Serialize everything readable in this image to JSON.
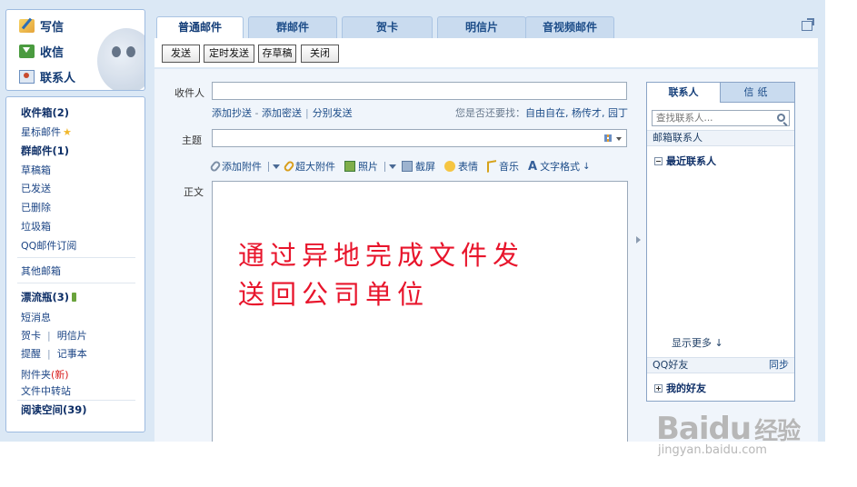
{
  "sidebar": {
    "top": [
      {
        "label": "写信",
        "icon": "pencil-icon"
      },
      {
        "label": "收信",
        "icon": "inbox-icon"
      },
      {
        "label": "联系人",
        "icon": "contact-card-icon"
      }
    ],
    "inbox": "收件箱(2)",
    "starred": "星标邮件",
    "group_mail": "群邮件(1)",
    "drafts": "草稿箱",
    "sent": "已发送",
    "deleted": "已删除",
    "trash": "垃圾箱",
    "subscriptions": "QQ邮件订阅",
    "other_mailboxes": "其他邮箱",
    "drift_bottle": "漂流瓶(3)",
    "sms": "短消息",
    "greeting_card": "贺卡",
    "postcard": "明信片",
    "reminder": "提醒",
    "notebook": "记事本",
    "attachments": "附件夹",
    "attachments_new": "(新)",
    "file_transfer": "文件中转站",
    "reading_space": "阅读空间(39)"
  },
  "tabs": [
    "普通邮件",
    "群邮件",
    "贺卡",
    "明信片",
    "音视频邮件"
  ],
  "toolbar": {
    "send": "发送",
    "scheduled_send": "定时发送",
    "save_draft": "存草稿",
    "close": "关闭"
  },
  "compose": {
    "to_label": "收件人",
    "to_value": "",
    "add_cc": "添加抄送",
    "add_bcc": "添加密送",
    "separate_send": "分别发送",
    "hint_prefix": "您是否还要找：",
    "hint_names": "自由自在, 杨传才, 园丁",
    "subject_label": "主题",
    "subject_value": "",
    "add_attachment": "添加附件",
    "large_attachment": "超大附件",
    "photo": "照片",
    "screenshot": "截屏",
    "emoji": "表情",
    "music": "音乐",
    "text_format": "文字格式",
    "body_label": "正文",
    "annotation_line1": "通过异地完成文件发",
    "annotation_line2": "送回公司单位"
  },
  "right_panel": {
    "tab_contacts": "联系人",
    "tab_stationery": "信纸",
    "search_placeholder": "查找联系人...",
    "mail_contacts": "邮箱联系人",
    "recent_contacts": "最近联系人",
    "show_more": "显示更多",
    "qq_friends": "QQ好友",
    "sync": "同步",
    "my_friends": "我的好友"
  },
  "watermark": {
    "logo": "Bai",
    "logo_cn": "经验",
    "url": "jingyan.baidu.com"
  }
}
